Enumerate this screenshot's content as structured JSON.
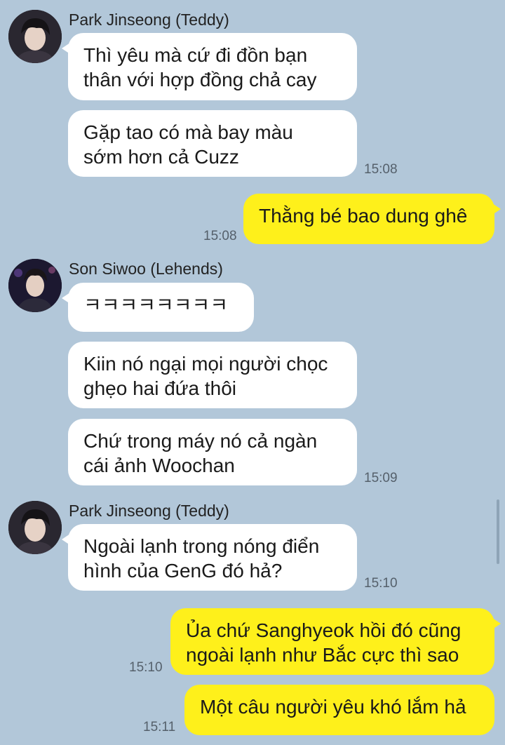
{
  "chat": {
    "groups": [
      {
        "sender": "Park Jinseong (Teddy)",
        "avatar_icon": "profile-avatar",
        "messages": [
          "Thì yêu mà cứ đi đồn bạn\nthân với hợp đồng chả cay",
          "Gặp tao có mà bay màu\nsớm hơn cả Cuzz"
        ],
        "time": "15:08"
      },
      {
        "sender": "me",
        "messages": [
          "Thằng bé bao dung ghê"
        ],
        "time": "15:08"
      },
      {
        "sender": "Son Siwoo (Lehends)",
        "avatar_icon": "profile-avatar",
        "messages": [
          "ㅋㅋㅋㅋㅋㅋㅋㅋ",
          "Kiin nó ngại mọi người chọc\nghẹo hai đứa thôi",
          "Chứ trong máy nó cả ngàn\ncái ảnh Woochan"
        ],
        "time": "15:09"
      },
      {
        "sender": "Park Jinseong (Teddy)",
        "avatar_icon": "profile-avatar",
        "messages": [
          "Ngoài lạnh trong nóng điển\nhình của GenG đó hả?"
        ],
        "time": "15:10"
      },
      {
        "sender": "me",
        "messages": [
          "Ủa chứ Sanghyeok hồi đó cũng\nngoài lạnh như Bắc cực thì sao"
        ],
        "time": "15:10"
      },
      {
        "sender": "me",
        "messages": [
          "Một câu người yêu khó lắm hả"
        ],
        "time": "15:11"
      }
    ]
  },
  "colors": {
    "background": "#b2c7d9",
    "my_bubble": "#fef01b",
    "their_bubble": "#ffffff"
  }
}
